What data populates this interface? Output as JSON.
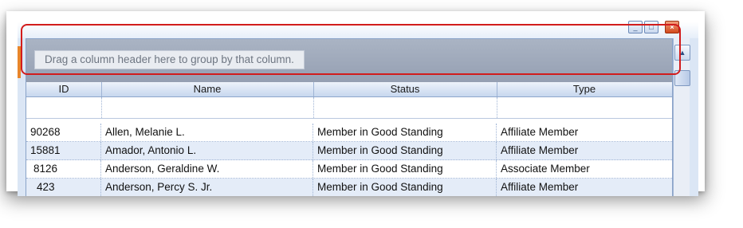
{
  "group_panel": {
    "hint": "Drag a column header here to group by that column."
  },
  "columns": [
    {
      "label": "ID"
    },
    {
      "label": "Name"
    },
    {
      "label": "Status"
    },
    {
      "label": "Type"
    }
  ],
  "rows": [
    {
      "id": "90268",
      "name": "Allen, Melanie L.",
      "status": "Member in Good Standing",
      "type": "Affiliate Member"
    },
    {
      "id": "15881",
      "name": "Amador, Antonio L.",
      "status": "Member in Good Standing",
      "type": "Affiliate Member"
    },
    {
      "id": "8126",
      "name": "Anderson, Geraldine W.",
      "status": "Member in Good Standing",
      "type": "Associate Member"
    },
    {
      "id": "423",
      "name": "Anderson, Percy S. Jr.",
      "status": "Member in Good Standing",
      "type": "Affiliate Member"
    }
  ],
  "colors": {
    "highlight": "#d21c1c",
    "row_alt": "#e4ecf8",
    "group_panel": "#9ea8ba"
  },
  "icons": {
    "minimize": "minimize-icon",
    "maximize": "maximize-icon",
    "close": "close-icon",
    "scroll_up": "chevron-up-icon"
  }
}
